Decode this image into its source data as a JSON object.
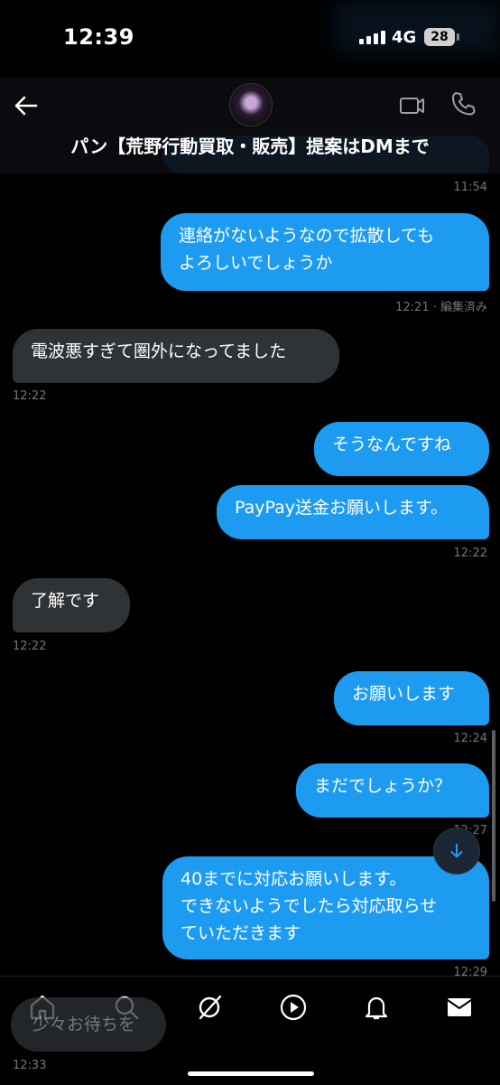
{
  "status_bar": {
    "time": "12:39",
    "network": "4G",
    "battery": "28"
  },
  "header": {
    "title": "パン【荒野行動買取・販売】提案はDMまで"
  },
  "messages": [
    {
      "time": "11:54"
    },
    {
      "text": "連絡がないようなので拡散しても\nよろしいでしょうか",
      "time": "12:21 · 編集済み"
    },
    {
      "text": "電波悪すぎて圏外になってました",
      "time": "12:22"
    },
    {
      "text": "そうなんですね"
    },
    {
      "text": "PayPay送金お願いします。",
      "time": "12:22"
    },
    {
      "text": "了解です",
      "time": "12:22"
    },
    {
      "text": "お願いします",
      "time": "12:24"
    },
    {
      "text": "まだでしょうか？",
      "time": "12:27"
    },
    {
      "text": "40までに対応お願いします。\nできないようでしたら対応取らせ\nていただきます",
      "time": "12:29"
    },
    {
      "text": "少々お待ちを",
      "time": "12:33"
    }
  ],
  "icons": [
    "back-arrow-icon",
    "video-camera-icon",
    "phone-icon",
    "arrow-down-icon",
    "home-icon",
    "search-icon",
    "grok-icon",
    "play-icon",
    "bell-icon",
    "mail-icon"
  ],
  "colors": {
    "accent": "#1d9bf0",
    "incoming": "#2f3336",
    "muted": "#71767b"
  }
}
